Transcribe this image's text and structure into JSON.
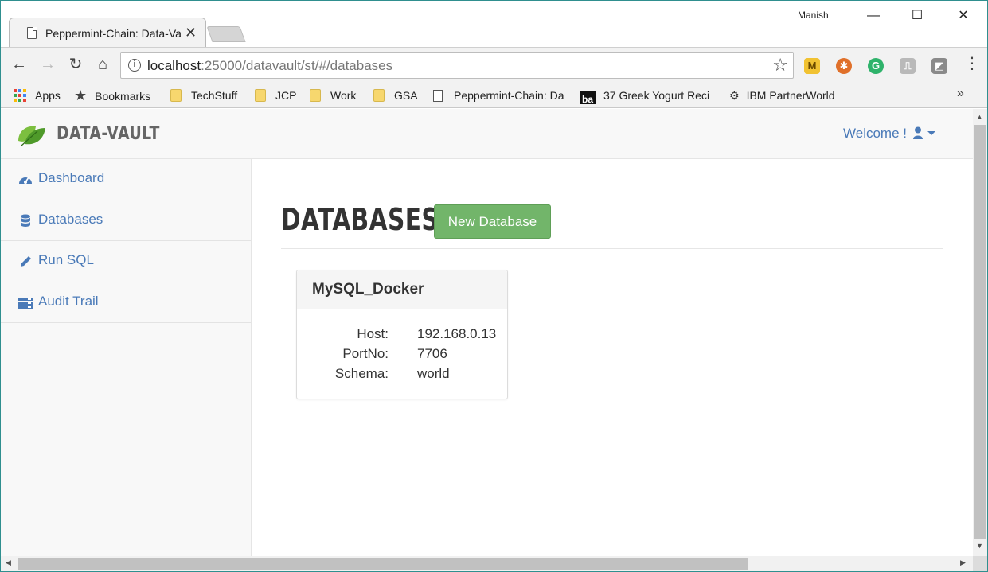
{
  "browser": {
    "tab_title": "Peppermint-Chain: Data-Vault",
    "user_name": "Manish",
    "url_host": "localhost",
    "url_rest": ":25000/datavault/st/#/databases",
    "bookmarks": {
      "apps": "Apps",
      "bookmarks": "Bookmarks",
      "techstuff": "TechStuff",
      "jcp": "JCP",
      "work": "Work",
      "gsa": "GSA",
      "peppermint": "Peppermint-Chain: Da",
      "greek_yogurt": "37 Greek Yogurt Reci",
      "ibm": "IBM PartnerWorld",
      "more": "»"
    },
    "extensions": [
      {
        "name": "m-extension-icon",
        "glyph": "M",
        "color": "#f1c232"
      },
      {
        "name": "lifebuoy-extension-icon",
        "glyph": "✱",
        "color": "#e0702a"
      },
      {
        "name": "grammarly-extension-icon",
        "glyph": "G",
        "color": "#2fb36b"
      },
      {
        "name": "pdf-extension-icon",
        "glyph": "⎍",
        "color": "#b9b9b9"
      },
      {
        "name": "shield-extension-icon",
        "glyph": "◩",
        "color": "#8a8a8a"
      }
    ]
  },
  "app": {
    "brand": "DATA-VAULT",
    "welcome": "Welcome !",
    "sidebar": {
      "items": [
        {
          "label": "Dashboard",
          "icon": "dashboard-icon"
        },
        {
          "label": "Databases",
          "icon": "database-icon"
        },
        {
          "label": "Run SQL",
          "icon": "pencil-icon"
        },
        {
          "label": "Audit Trail",
          "icon": "server-list-icon"
        }
      ]
    },
    "main": {
      "title": "DATABASES",
      "new_button": "New Database",
      "card": {
        "name": "MySQL_Docker",
        "host_label": "Host:",
        "host": "192.168.0.13",
        "port_label": "PortNo:",
        "port": "7706",
        "schema_label": "Schema:",
        "schema": "world"
      }
    }
  }
}
